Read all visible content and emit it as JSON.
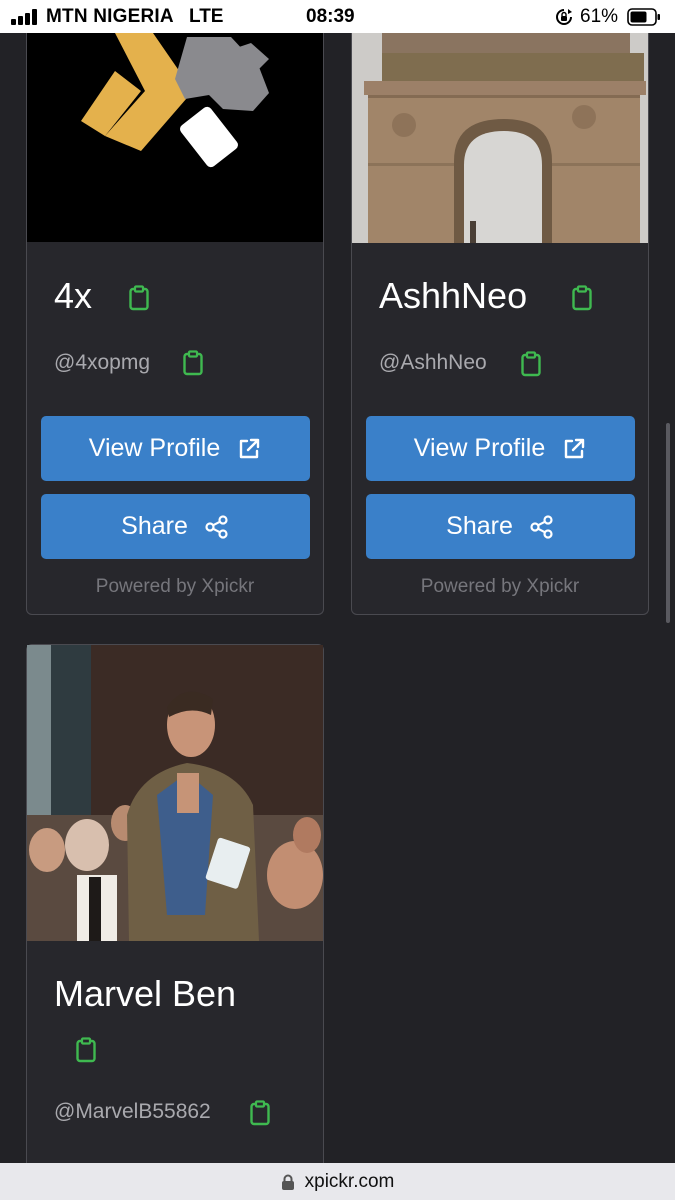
{
  "status_bar": {
    "carrier": "MTN NIGERIA",
    "network": "LTE",
    "time": "08:39",
    "battery_percent": "61%"
  },
  "cards": [
    {
      "name": "4x",
      "handle": "@4xopmg",
      "view_profile_label": "View Profile",
      "share_label": "Share",
      "powered_by": "Powered by Xpickr"
    },
    {
      "name": "AshhNeo",
      "handle": "@AshhNeo",
      "view_profile_label": "View Profile",
      "share_label": "Share",
      "powered_by": "Powered by Xpickr"
    },
    {
      "name": "Marvel Ben",
      "handle": "@MarvelB55862"
    }
  ],
  "url_bar": {
    "url": "xpickr.com"
  },
  "colors": {
    "background": "#222226",
    "card": "#27272c",
    "button": "#3a80c9",
    "clipboard_icon": "#3fb950"
  },
  "icons": [
    "signal-icon",
    "rotation-lock-icon",
    "battery-icon",
    "clipboard-icon",
    "external-link-icon",
    "share-icon",
    "padlock-icon"
  ]
}
